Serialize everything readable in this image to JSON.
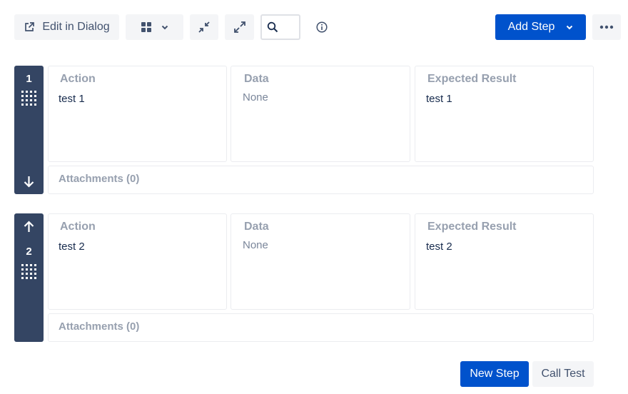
{
  "toolbar": {
    "edit_label": "Edit in Dialog",
    "add_step_label": "Add Step",
    "search_placeholder": ""
  },
  "labels": {
    "action": "Action",
    "data": "Data",
    "expected": "Expected Result"
  },
  "steps": [
    {
      "number": "1",
      "action": "test 1",
      "data": "None",
      "expected": "test 1",
      "attachments": "Attachments (0)"
    },
    {
      "number": "2",
      "action": "test 2",
      "data": "None",
      "expected": "test 2",
      "attachments": "Attachments (0)"
    }
  ],
  "footer": {
    "new_step_label": "New Step",
    "call_test_label": "Call Test"
  },
  "colors": {
    "primary": "#0052cc",
    "step_bar": "#344563",
    "header_text": "#97a0af",
    "button_bg": "#f4f5f7"
  },
  "icons": [
    "external-link-icon",
    "grid-view-icon",
    "chevron-down-icon",
    "collapse-icon",
    "expand-icon",
    "search-icon",
    "info-icon",
    "more-icon",
    "drag-handle-icon",
    "arrow-down-icon",
    "arrow-up-icon"
  ]
}
